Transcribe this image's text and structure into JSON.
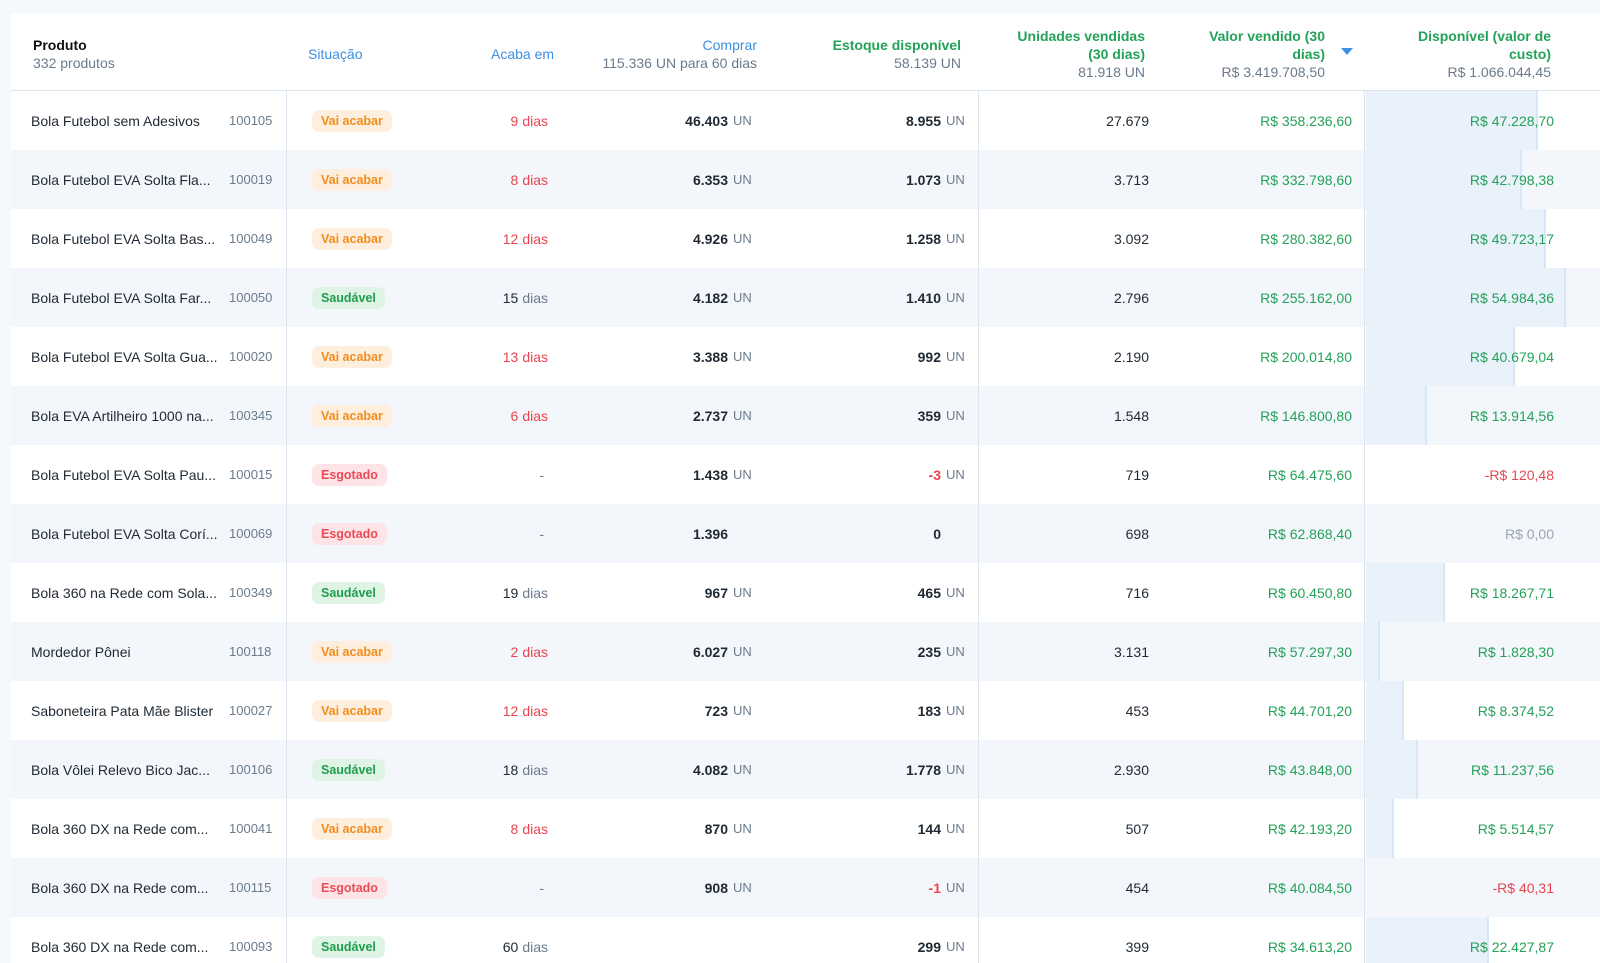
{
  "header": {
    "produto": {
      "label": "Produto",
      "sub": "332 produtos"
    },
    "situacao": {
      "label": "Situação"
    },
    "acaba": {
      "label": "Acaba em"
    },
    "comprar": {
      "label": "Comprar",
      "sub": "115.336 UN para 60 dias"
    },
    "estoque": {
      "label": "Estoque disponível",
      "sub": "58.139 UN"
    },
    "unidades": {
      "label1": "Unidades vendidas",
      "label2": "(30 dias)",
      "sub": "81.918 UN"
    },
    "valor": {
      "label1": "Valor vendido (30",
      "label2": "dias)",
      "sub": "R$ 3.419.708,50"
    },
    "disponivel": {
      "label1": "Disponível (valor de",
      "label2": "custo)",
      "sub": "R$ 1.066.044,45"
    }
  },
  "colors": {
    "warn": "#f28d1c",
    "ok": "#1f9d4e",
    "out": "#ea4b57",
    "accent": "#3d8fe0"
  },
  "rows": [
    {
      "name": "Bola Futebol sem Adesivos",
      "code": "100105",
      "status": "Vai acabar",
      "status_type": "warn",
      "ends_num": "9",
      "ends_unit": "dias",
      "ends_type": "red",
      "buy": "46.403",
      "buy_un": "UN",
      "stock": "8.955",
      "stock_un": "UN",
      "stock_neg": false,
      "sold": "27.679",
      "value": "R$ 358.236,60",
      "avail": "R$ 47.228,70",
      "avail_type": "green",
      "bar_pct": 0.86
    },
    {
      "name": "Bola Futebol EVA Solta Fla...",
      "code": "100019",
      "status": "Vai acabar",
      "status_type": "warn",
      "ends_num": "8",
      "ends_unit": "dias",
      "ends_type": "red",
      "buy": "6.353",
      "buy_un": "UN",
      "stock": "1.073",
      "stock_un": "UN",
      "stock_neg": false,
      "sold": "3.713",
      "value": "R$ 332.798,60",
      "avail": "R$ 42.798,38",
      "avail_type": "green",
      "bar_pct": 0.78
    },
    {
      "name": "Bola Futebol EVA Solta Bas...",
      "code": "100049",
      "status": "Vai acabar",
      "status_type": "warn",
      "ends_num": "12",
      "ends_unit": "dias",
      "ends_type": "red",
      "buy": "4.926",
      "buy_un": "UN",
      "stock": "1.258",
      "stock_un": "UN",
      "stock_neg": false,
      "sold": "3.092",
      "value": "R$ 280.382,60",
      "avail": "R$ 49.723,17",
      "avail_type": "green",
      "bar_pct": 0.9
    },
    {
      "name": "Bola Futebol EVA Solta Far...",
      "code": "100050",
      "status": "Saudável",
      "status_type": "ok",
      "ends_num": "15",
      "ends_unit": "dias",
      "ends_type": "normal",
      "buy": "4.182",
      "buy_un": "UN",
      "stock": "1.410",
      "stock_un": "UN",
      "stock_neg": false,
      "sold": "2.796",
      "value": "R$ 255.162,00",
      "avail": "R$ 54.984,36",
      "avail_type": "green",
      "bar_pct": 1.0
    },
    {
      "name": "Bola Futebol EVA Solta Gua...",
      "code": "100020",
      "status": "Vai acabar",
      "status_type": "warn",
      "ends_num": "13",
      "ends_unit": "dias",
      "ends_type": "red",
      "buy": "3.388",
      "buy_un": "UN",
      "stock": "992",
      "stock_un": "UN",
      "stock_neg": false,
      "sold": "2.190",
      "value": "R$ 200.014,80",
      "avail": "R$ 40.679,04",
      "avail_type": "green",
      "bar_pct": 0.74
    },
    {
      "name": "Bola EVA Artilheiro 1000 na...",
      "code": "100345",
      "status": "Vai acabar",
      "status_type": "warn",
      "ends_num": "6",
      "ends_unit": "dias",
      "ends_type": "red",
      "buy": "2.737",
      "buy_un": "UN",
      "stock": "359",
      "stock_un": "UN",
      "stock_neg": false,
      "sold": "1.548",
      "value": "R$ 146.800,80",
      "avail": "R$ 13.914,56",
      "avail_type": "green",
      "bar_pct": 0.3
    },
    {
      "name": "Bola Futebol EVA Solta Pau...",
      "code": "100015",
      "status": "Esgotado",
      "status_type": "out",
      "ends_num": "-",
      "ends_unit": "",
      "ends_type": "dash",
      "buy": "1.438",
      "buy_un": "UN",
      "stock": "-3",
      "stock_un": "UN",
      "stock_neg": true,
      "sold": "719",
      "value": "R$ 64.475,60",
      "avail": "-R$ 120,48",
      "avail_type": "red",
      "bar_pct": 0
    },
    {
      "name": "Bola Futebol EVA Solta Corí...",
      "code": "100069",
      "status": "Esgotado",
      "status_type": "out",
      "ends_num": "-",
      "ends_unit": "",
      "ends_type": "dash",
      "buy": "1.396",
      "buy_un": "",
      "stock": "0",
      "stock_un": "",
      "stock_neg": false,
      "sold": "698",
      "value": "R$ 62.868,40",
      "avail": "R$ 0,00",
      "avail_type": "muted",
      "bar_pct": 0
    },
    {
      "name": "Bola 360 na Rede com Sola...",
      "code": "100349",
      "status": "Saudável",
      "status_type": "ok",
      "ends_num": "19",
      "ends_unit": "dias",
      "ends_type": "normal",
      "buy": "967",
      "buy_un": "UN",
      "stock": "465",
      "stock_un": "UN",
      "stock_neg": false,
      "sold": "716",
      "value": "R$ 60.450,80",
      "avail": "R$ 18.267,71",
      "avail_type": "green",
      "bar_pct": 0.39
    },
    {
      "name": "Mordedor Pônei",
      "code": "100118",
      "status": "Vai acabar",
      "status_type": "warn",
      "ends_num": "2",
      "ends_unit": "dias",
      "ends_type": "red",
      "buy": "6.027",
      "buy_un": "UN",
      "stock": "235",
      "stock_un": "UN",
      "stock_neg": false,
      "sold": "3.131",
      "value": "R$ 57.297,30",
      "avail": "R$ 1.828,30",
      "avail_type": "green",
      "bar_pct": 0.06
    },
    {
      "name": "Saboneteira Pata Mãe Blister",
      "code": "100027",
      "status": "Vai acabar",
      "status_type": "warn",
      "ends_num": "12",
      "ends_unit": "dias",
      "ends_type": "red",
      "buy": "723",
      "buy_un": "UN",
      "stock": "183",
      "stock_un": "UN",
      "stock_neg": false,
      "sold": "453",
      "value": "R$ 44.701,20",
      "avail": "R$ 8.374,52",
      "avail_type": "green",
      "bar_pct": 0.18
    },
    {
      "name": "Bola Vôlei Relevo Bico Jac...",
      "code": "100106",
      "status": "Saudável",
      "status_type": "ok",
      "ends_num": "18",
      "ends_unit": "dias",
      "ends_type": "normal",
      "buy": "4.082",
      "buy_un": "UN",
      "stock": "1.778",
      "stock_un": "UN",
      "stock_neg": false,
      "sold": "2.930",
      "value": "R$ 43.848,00",
      "avail": "R$ 11.237,56",
      "avail_type": "green",
      "bar_pct": 0.25
    },
    {
      "name": "Bola 360 DX na Rede com...",
      "code": "100041",
      "status": "Vai acabar",
      "status_type": "warn",
      "ends_num": "8",
      "ends_unit": "dias",
      "ends_type": "red",
      "buy": "870",
      "buy_un": "UN",
      "stock": "144",
      "stock_un": "UN",
      "stock_neg": false,
      "sold": "507",
      "value": "R$ 42.193,20",
      "avail": "R$ 5.514,57",
      "avail_type": "green",
      "bar_pct": 0.13
    },
    {
      "name": "Bola 360 DX na Rede com...",
      "code": "100115",
      "status": "Esgotado",
      "status_type": "out",
      "ends_num": "-",
      "ends_unit": "",
      "ends_type": "dash",
      "buy": "908",
      "buy_un": "UN",
      "stock": "-1",
      "stock_un": "UN",
      "stock_neg": true,
      "sold": "454",
      "value": "R$ 40.084,50",
      "avail": "-R$ 40,31",
      "avail_type": "red",
      "bar_pct": 0
    },
    {
      "name": "Bola 360 DX na Rede com...",
      "code": "100093",
      "status": "Saudável",
      "status_type": "ok",
      "ends_num": "60",
      "ends_unit": "dias",
      "ends_type": "normal",
      "buy": "",
      "buy_un": "",
      "stock": "299",
      "stock_un": "UN",
      "stock_neg": false,
      "sold": "399",
      "value": "R$ 34.613,20",
      "avail": "R$ 22.427,87",
      "avail_type": "green",
      "bar_pct": 0.61
    }
  ]
}
